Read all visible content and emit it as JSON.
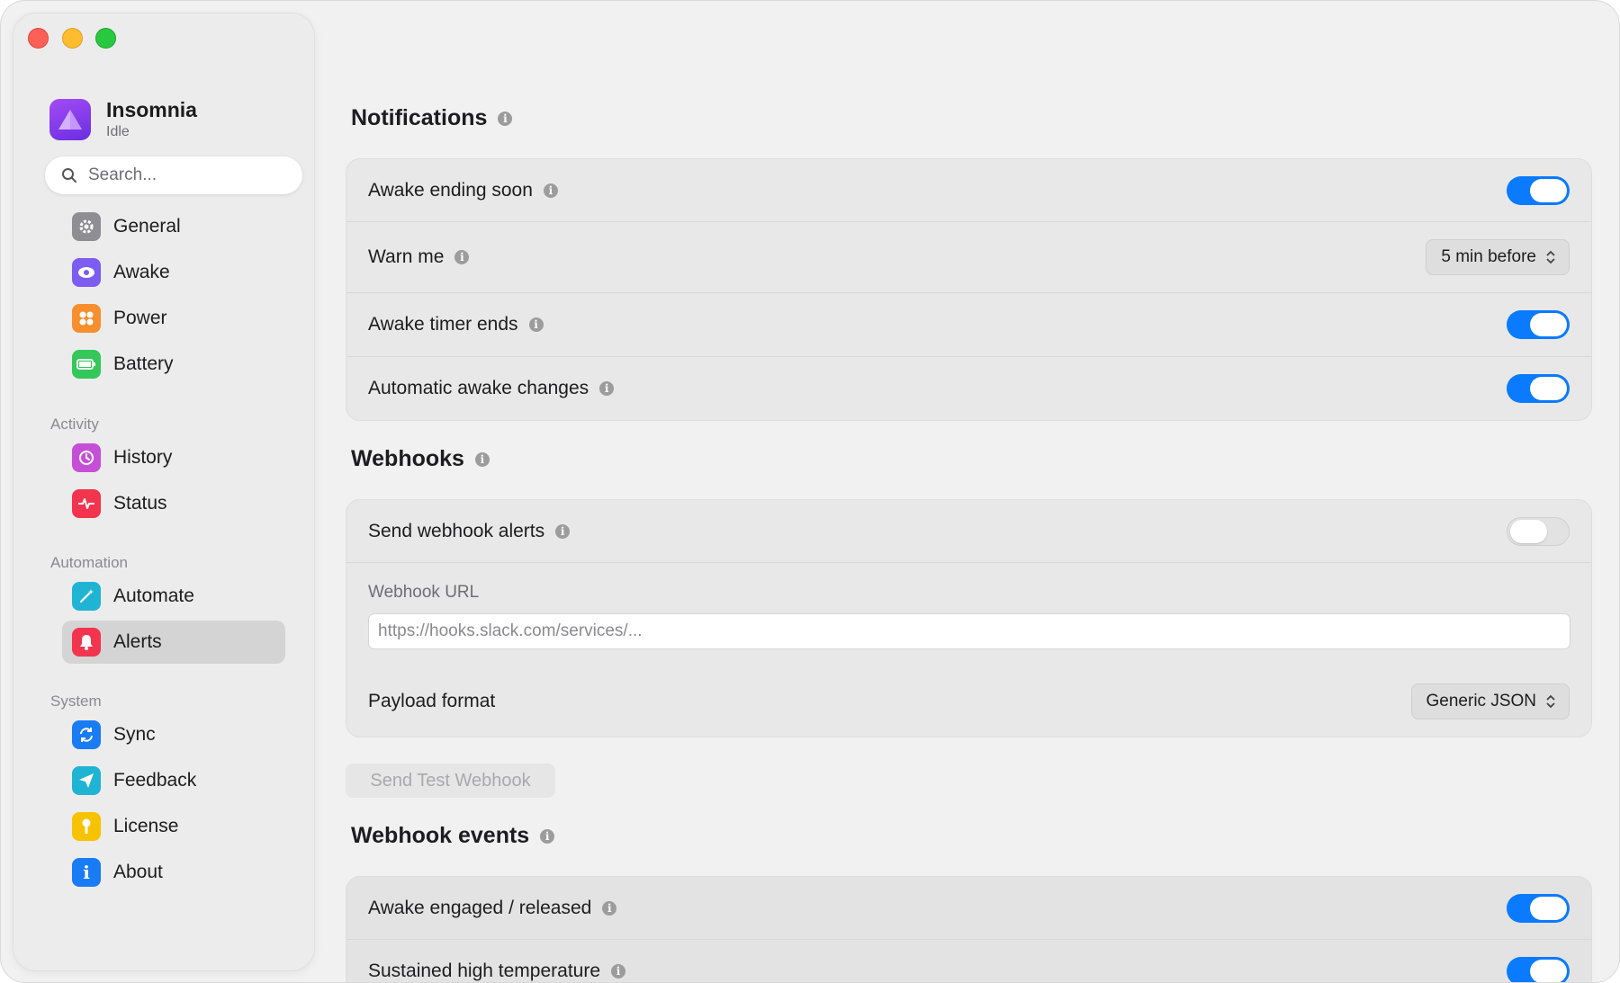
{
  "app": {
    "name": "Insomnia",
    "status": "Idle"
  },
  "search": {
    "placeholder": "Search..."
  },
  "sidebar": {
    "items": [
      {
        "label": "General"
      },
      {
        "label": "Awake"
      },
      {
        "label": "Power"
      },
      {
        "label": "Battery"
      }
    ],
    "sections": [
      {
        "label": "Activity",
        "items": [
          {
            "label": "History"
          },
          {
            "label": "Status"
          }
        ]
      },
      {
        "label": "Automation",
        "items": [
          {
            "label": "Automate"
          },
          {
            "label": "Alerts"
          }
        ]
      },
      {
        "label": "System",
        "items": [
          {
            "label": "Sync"
          },
          {
            "label": "Feedback"
          },
          {
            "label": "License"
          },
          {
            "label": "About"
          }
        ]
      }
    ],
    "active": "Alerts"
  },
  "notifications": {
    "title": "Notifications",
    "awake_ending_soon": {
      "label": "Awake ending soon",
      "on": true
    },
    "warn_me": {
      "label": "Warn me",
      "value": "5 min before"
    },
    "awake_timer_ends": {
      "label": "Awake timer ends",
      "on": true
    },
    "automatic_awake_changes": {
      "label": "Automatic awake changes",
      "on": true
    }
  },
  "webhooks": {
    "title": "Webhooks",
    "send_alerts": {
      "label": "Send webhook alerts",
      "on": false
    },
    "url": {
      "label": "Webhook URL",
      "placeholder": "https://hooks.slack.com/services/..."
    },
    "payload_format": {
      "label": "Payload format",
      "value": "Generic JSON"
    },
    "test_button": "Send Test Webhook"
  },
  "webhook_events": {
    "title": "Webhook events",
    "awake_engaged": {
      "label": "Awake engaged / released",
      "on": true
    },
    "sustained_temp": {
      "label": "Sustained high temperature",
      "on": true
    }
  },
  "colors": {
    "accent": "#0a7aff",
    "toggle_off": "#e2e2e2"
  }
}
